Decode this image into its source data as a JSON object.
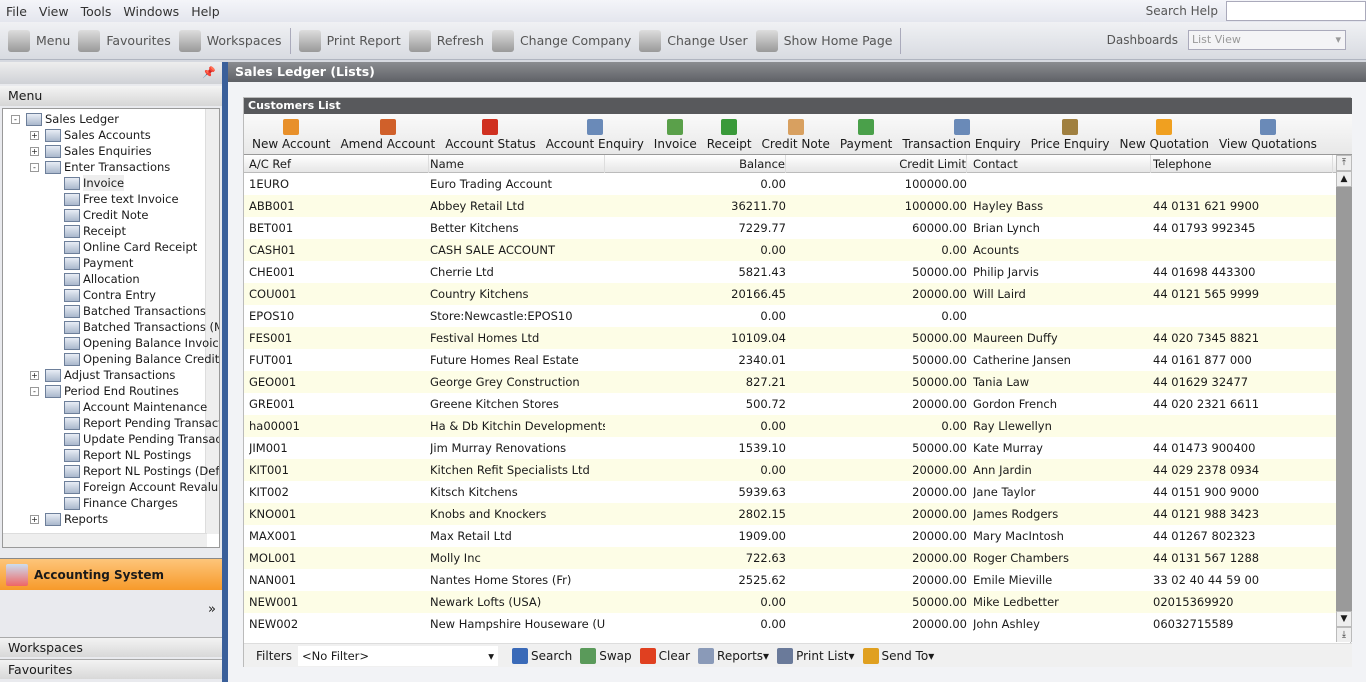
{
  "menubar": {
    "items": [
      "File",
      "View",
      "Tools",
      "Windows",
      "Help"
    ],
    "search_help": "Search Help"
  },
  "toolbar": {
    "items": [
      {
        "label": "Menu",
        "icon": "menu-icon"
      },
      {
        "label": "Favourites",
        "icon": "star-icon"
      },
      {
        "label": "Workspaces",
        "icon": "workspaces-icon"
      },
      {
        "label": "Print Report",
        "icon": "printer-icon"
      },
      {
        "label": "Refresh",
        "icon": "refresh-icon"
      },
      {
        "label": "Change Company",
        "icon": "company-icon"
      },
      {
        "label": "Change User",
        "icon": "user-icon"
      },
      {
        "label": "Show Home Page",
        "icon": "home-icon"
      }
    ],
    "dashboards_label": "Dashboards",
    "dashboards_value": "List View"
  },
  "sidebar": {
    "header": "Menu",
    "tree": [
      {
        "label": "Sales Ledger",
        "level": 0,
        "exp": "-"
      },
      {
        "label": "Sales Accounts",
        "level": 1,
        "exp": "+"
      },
      {
        "label": "Sales Enquiries",
        "level": 1,
        "exp": "+"
      },
      {
        "label": "Enter Transactions",
        "level": 1,
        "exp": "-"
      },
      {
        "label": "Invoice",
        "level": 2
      },
      {
        "label": "Free text Invoice",
        "level": 2
      },
      {
        "label": "Credit Note",
        "level": 2
      },
      {
        "label": "Receipt",
        "level": 2
      },
      {
        "label": "Online Card Receipt",
        "level": 2
      },
      {
        "label": "Payment",
        "level": 2
      },
      {
        "label": "Allocation",
        "level": 2
      },
      {
        "label": "Contra Entry",
        "level": 2
      },
      {
        "label": "Batched Transactions",
        "level": 2
      },
      {
        "label": "Batched Transactions (Ma",
        "level": 2
      },
      {
        "label": "Opening Balance Invoice",
        "level": 2
      },
      {
        "label": "Opening Balance Credit",
        "level": 2
      },
      {
        "label": "Adjust Transactions",
        "level": 1,
        "exp": "+"
      },
      {
        "label": "Period End Routines",
        "level": 1,
        "exp": "-"
      },
      {
        "label": "Account Maintenance",
        "level": 2
      },
      {
        "label": "Report Pending Transact",
        "level": 2
      },
      {
        "label": "Update Pending Transact",
        "level": 2
      },
      {
        "label": "Report NL Postings",
        "level": 2
      },
      {
        "label": "Report NL Postings (Defe",
        "level": 2
      },
      {
        "label": "Foreign Account Revalua",
        "level": 2
      },
      {
        "label": "Finance Charges",
        "level": 2
      },
      {
        "label": "Reports",
        "level": 1,
        "exp": "+"
      }
    ],
    "accounting_system": "Accounting System",
    "workspaces": "Workspaces",
    "favourites": "Favourites"
  },
  "main": {
    "title": "Sales Ledger (Lists)",
    "list_title": "Customers List",
    "actions": [
      {
        "label": "New Account",
        "color": "#e8902a"
      },
      {
        "label": "Amend Account",
        "color": "#d0602a"
      },
      {
        "label": "Account Status",
        "color": "#d03020"
      },
      {
        "label": "Account Enquiry",
        "color": "#6a8ab8"
      },
      {
        "label": "Invoice",
        "color": "#5aa04a"
      },
      {
        "label": "Receipt",
        "color": "#3a9a3a"
      },
      {
        "label": "Credit Note",
        "color": "#d8a060"
      },
      {
        "label": "Payment",
        "color": "#4aa04a"
      },
      {
        "label": "Transaction Enquiry",
        "color": "#6a8ab8"
      },
      {
        "label": "Price Enquiry",
        "color": "#a08040"
      },
      {
        "label": "New Quotation",
        "color": "#f0a020"
      },
      {
        "label": "View Quotations",
        "color": "#6a8ab8"
      }
    ],
    "columns": [
      "A/C Ref",
      "Name",
      "Balance",
      "Credit Limit",
      "Contact",
      "Telephone"
    ],
    "rows": [
      [
        "1EURO",
        "Euro Trading Account",
        "0.00",
        "100000.00",
        "",
        ""
      ],
      [
        "ABB001",
        "Abbey Retail Ltd",
        "36211.70",
        "100000.00",
        "Hayley Bass",
        "44 0131 621 9900"
      ],
      [
        "BET001",
        "Better Kitchens",
        "7229.77",
        "60000.00",
        "Brian Lynch",
        "44 01793 992345"
      ],
      [
        "CASH01",
        "CASH SALE ACCOUNT",
        "0.00",
        "0.00",
        "Acounts",
        ""
      ],
      [
        "CHE001",
        "Cherrie Ltd",
        "5821.43",
        "50000.00",
        "Philip Jarvis",
        "44 01698 443300"
      ],
      [
        "COU001",
        "Country Kitchens",
        "20166.45",
        "20000.00",
        "Will Laird",
        "44 0121 565 9999"
      ],
      [
        "EPOS10",
        "Store:Newcastle:EPOS10",
        "0.00",
        "0.00",
        "",
        ""
      ],
      [
        "FES001",
        "Festival Homes Ltd",
        "10109.04",
        "50000.00",
        "Maureen Duffy",
        "44 020 7345 8821"
      ],
      [
        "FUT001",
        "Future Homes Real Estate",
        "2340.01",
        "50000.00",
        "Catherine Jansen",
        "44 0161 877 000"
      ],
      [
        "GEO001",
        "George Grey Construction",
        "827.21",
        "50000.00",
        "Tania Law",
        "44 01629 32477"
      ],
      [
        "GRE001",
        "Greene Kitchen Stores",
        "500.72",
        "20000.00",
        "Gordon French",
        "44 020 2321 6611"
      ],
      [
        "ha00001",
        "Ha & Db Kitchin Developments L...",
        "0.00",
        "0.00",
        "Ray Llewellyn",
        ""
      ],
      [
        "JIM001",
        "Jim Murray Renovations",
        "1539.10",
        "50000.00",
        "Kate Murray",
        "44 01473 900400"
      ],
      [
        "KIT001",
        "Kitchen Refit Specialists Ltd",
        "0.00",
        "20000.00",
        "Ann Jardin",
        "44 029 2378 0934"
      ],
      [
        "KIT002",
        "Kitsch Kitchens",
        "5939.63",
        "20000.00",
        "Jane Taylor",
        "44 0151 900 9000"
      ],
      [
        "KNO001",
        "Knobs and Knockers",
        "2802.15",
        "20000.00",
        "James Rodgers",
        "44 0121 988 3423"
      ],
      [
        "MAX001",
        "Max Retail Ltd",
        "1909.00",
        "20000.00",
        "Mary MacIntosh",
        "44 01267 802323"
      ],
      [
        "MOL001",
        "Molly Inc",
        "722.63",
        "20000.00",
        "Roger Chambers",
        "44 0131 567 1288"
      ],
      [
        "NAN001",
        "Nantes Home Stores (Fr)",
        "2525.62",
        "20000.00",
        "Emile Mieville",
        "33 02 40 44 59 00"
      ],
      [
        "NEW001",
        "Newark Lofts (USA)",
        "0.00",
        "50000.00",
        "Mike Ledbetter",
        "02015369920"
      ],
      [
        "NEW002",
        "New Hampshire Houseware (USA)",
        "0.00",
        "20000.00",
        "John Ashley",
        "06032715589"
      ]
    ],
    "filters_label": "Filters",
    "filter_value": "<No Filter>",
    "filter_actions": [
      {
        "label": "Search",
        "color": "#3a6ab8",
        "dd": false
      },
      {
        "label": "Swap",
        "color": "#5a9a5a",
        "dd": false
      },
      {
        "label": "Clear",
        "color": "#e04020",
        "dd": false
      },
      {
        "label": "Reports",
        "color": "#8a9ab8",
        "dd": true
      },
      {
        "label": "Print List",
        "color": "#6a7a9a",
        "dd": true
      },
      {
        "label": "Send To",
        "color": "#e0a020",
        "dd": true
      }
    ]
  }
}
